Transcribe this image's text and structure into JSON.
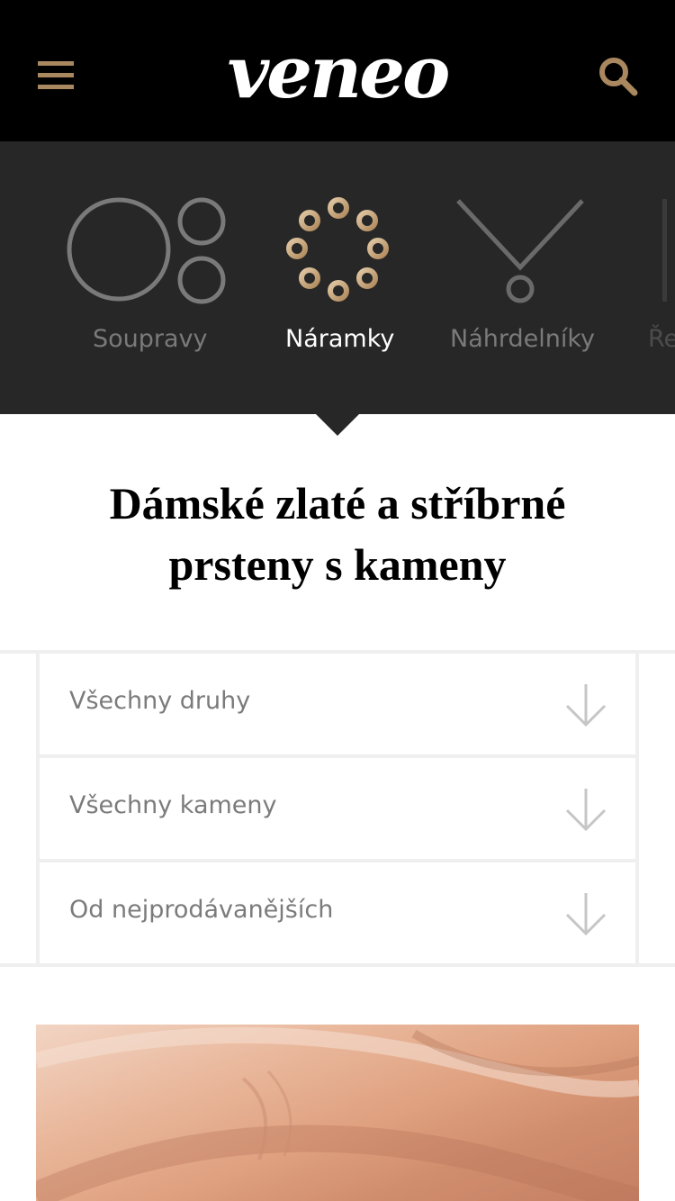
{
  "header": {
    "logo": "veneo",
    "menu_icon": "hamburger-menu-icon",
    "search_icon": "search-icon",
    "accent_color": "#a9875f"
  },
  "categories": {
    "items": [
      {
        "label": "Soupravy",
        "icon": "rings-set-icon",
        "active": false
      },
      {
        "label": "Náramky",
        "icon": "bracelet-icon",
        "active": true
      },
      {
        "label": "Náhrdelníky",
        "icon": "necklace-icon",
        "active": false
      },
      {
        "label": "Ře",
        "icon": "",
        "active": false
      }
    ],
    "bg_color": "#272727"
  },
  "page": {
    "title": "Dámské zlaté a stříbrné prsteny s kameny"
  },
  "filters": [
    {
      "label": "Všechny druhy",
      "icon": "arrow-down-icon"
    },
    {
      "label": "Všechny kameny",
      "icon": "arrow-down-icon"
    },
    {
      "label": "Od nejprodávanějších",
      "icon": "arrow-down-icon"
    }
  ],
  "hero_image": {
    "subject": "product-photo"
  }
}
